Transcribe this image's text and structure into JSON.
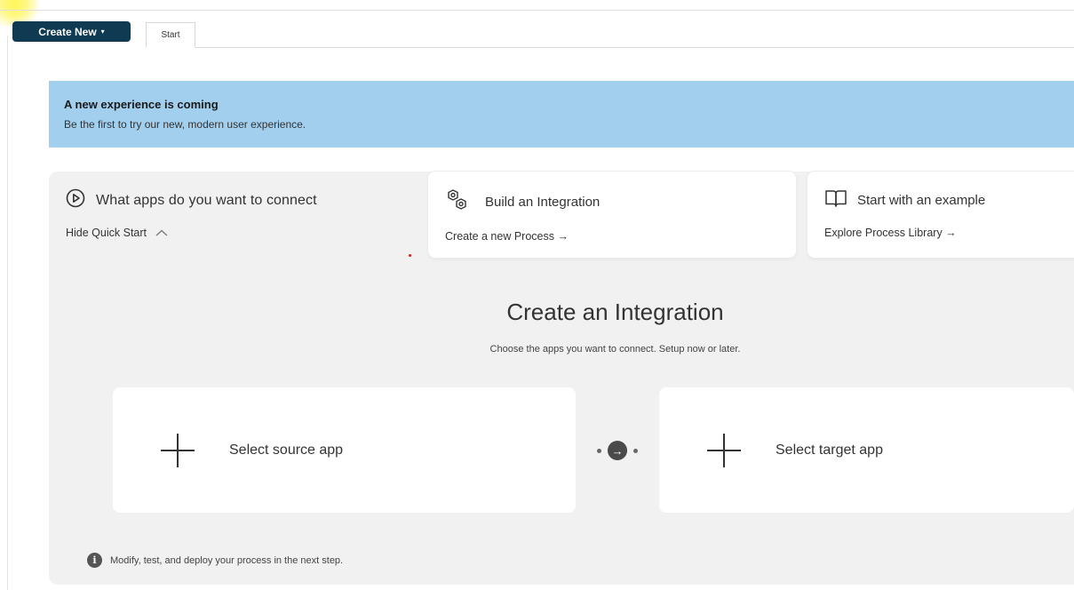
{
  "toolbar": {
    "create_new_label": "Create New",
    "create_new_caret": "▾",
    "tabs": [
      {
        "label": "Start"
      }
    ]
  },
  "banner": {
    "title": "A new experience is coming",
    "text": "Be the first to try our new, modern user experience."
  },
  "quick_start": {
    "first": {
      "icon": "play-circle-icon",
      "title": "What apps do you want to connect",
      "link": "Hide Quick Start",
      "link_icon": "chevron-up-icon"
    },
    "cards": [
      {
        "icon": "gears-icon",
        "title": "Build an Integration",
        "link": "Create a new Process →"
      },
      {
        "icon": "book-icon",
        "title": "Start with an example",
        "link": "Explore Process Library →"
      }
    ]
  },
  "create_integration": {
    "title": "Create an Integration",
    "subtitle": "Choose the apps you want to connect. Setup now or later.",
    "source_label": "Select source app",
    "target_label": "Select target app",
    "connector_icon": "arrow-right-circle-icon",
    "connector_glyph": "→"
  },
  "footer": {
    "icon": "info-icon",
    "icon_glyph": "i",
    "note": "Modify, test, and deploy your process in the next step."
  }
}
